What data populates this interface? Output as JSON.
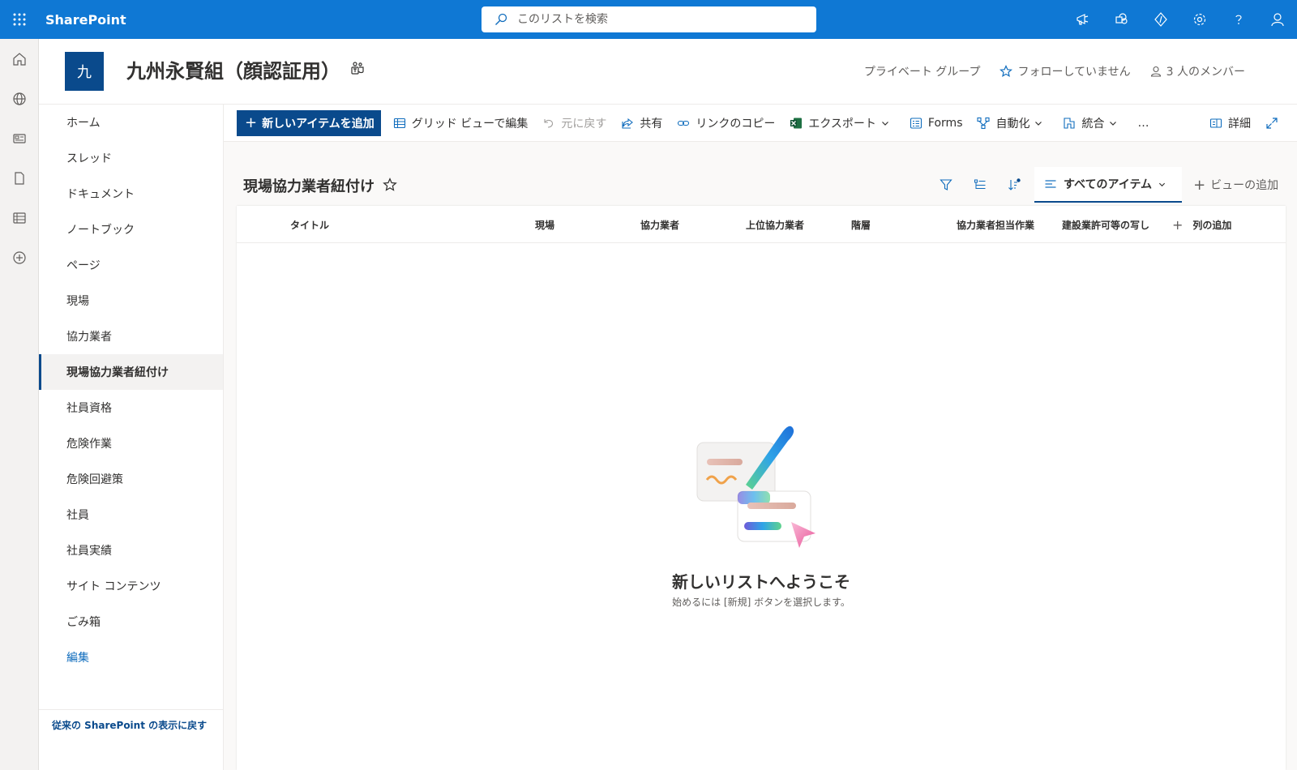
{
  "suite": {
    "brand": "SharePoint",
    "search_placeholder": "このリストを検索"
  },
  "site": {
    "logo_letter": "九",
    "title": "九州永賢組（顔認証用）",
    "privacy": "プライベート グループ",
    "follow": "フォローしていません",
    "members": "3 人のメンバー"
  },
  "nav": {
    "items": [
      {
        "label": "ホーム"
      },
      {
        "label": "スレッド"
      },
      {
        "label": "ドキュメント"
      },
      {
        "label": "ノートブック"
      },
      {
        "label": "ページ"
      },
      {
        "label": "現場"
      },
      {
        "label": "協力業者"
      },
      {
        "label": "現場協力業者紐付け"
      },
      {
        "label": "社員資格"
      },
      {
        "label": "危険作業"
      },
      {
        "label": "危険回避策"
      },
      {
        "label": "社員"
      },
      {
        "label": "社員実績"
      },
      {
        "label": "サイト コンテンツ"
      },
      {
        "label": "ごみ箱"
      },
      {
        "label": "編集"
      }
    ],
    "footer": "従来の SharePoint の表示に戻す"
  },
  "commandbar": {
    "new_item": "新しいアイテムを追加",
    "grid_edit": "グリッド ビューで編集",
    "undo": "元に戻す",
    "share": "共有",
    "copy_link": "リンクのコピー",
    "export": "エクスポート",
    "forms": "Forms",
    "automate": "自動化",
    "integrate": "統合",
    "more": "…",
    "details": "詳細"
  },
  "list": {
    "title": "現場協力業者紐付け",
    "view_name": "すべてのアイテム",
    "add_view": "ビューの追加",
    "columns": [
      "タイトル",
      "現場",
      "協力業者",
      "上位協力業者",
      "階層",
      "協力業者担当作業",
      "建設業許可等の写し"
    ],
    "add_column": "列の追加",
    "empty_title": "新しいリストへようこそ",
    "empty_subtitle": "始めるには [新規] ボタンを選択します。"
  },
  "colors": {
    "suitebar": "#0f78d4",
    "brand_dark": "#0a4a8c",
    "background": "#faf9f8"
  }
}
